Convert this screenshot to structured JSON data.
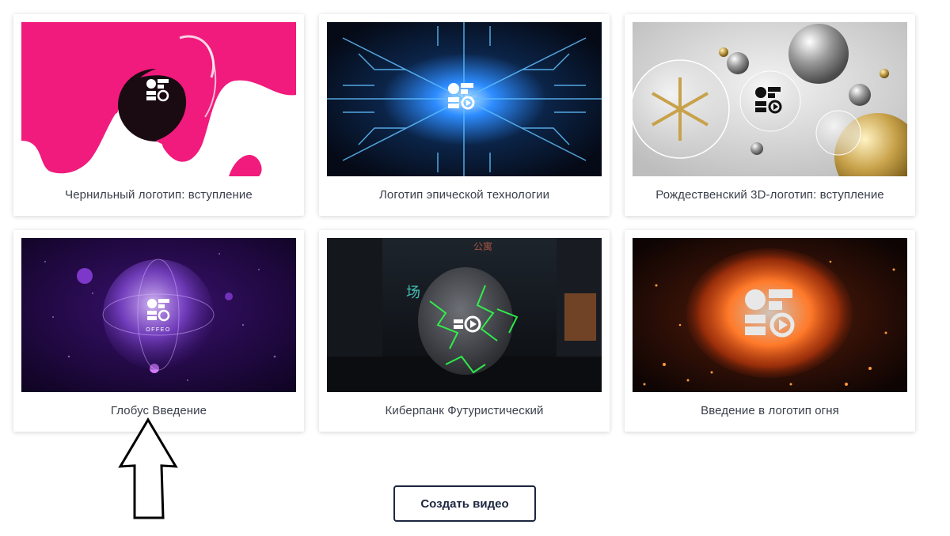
{
  "templates": [
    {
      "title": "Чернильный логотип: вступление",
      "theme": "ink",
      "colors": {
        "bg": "#ffffff",
        "accent": "#f01b7c"
      }
    },
    {
      "title": "Логотип эпической технологии",
      "theme": "tech",
      "colors": {
        "bg": "#060b18",
        "accent": "#3fa9ff"
      }
    },
    {
      "title": "Рождественский 3D-логотип: вступление",
      "theme": "christmas",
      "colors": {
        "bg": "#d9d9d9",
        "accent": "#c8a24a"
      }
    },
    {
      "title": "Глобус Введение",
      "theme": "globe",
      "colors": {
        "bg": "#1a0635",
        "accent": "#a24bff"
      }
    },
    {
      "title": "Киберпанк Футуристический",
      "theme": "cyberpunk",
      "colors": {
        "bg": "#12151a",
        "accent": "#2dff4a"
      }
    },
    {
      "title": "Введение в логотип огня",
      "theme": "fire",
      "colors": {
        "bg": "#120604",
        "accent": "#ff6a1a"
      }
    }
  ],
  "logo_text": "OFFEO",
  "cta_label": "Создать видео",
  "icons": {
    "pointer": "up-arrow-outline-icon"
  }
}
